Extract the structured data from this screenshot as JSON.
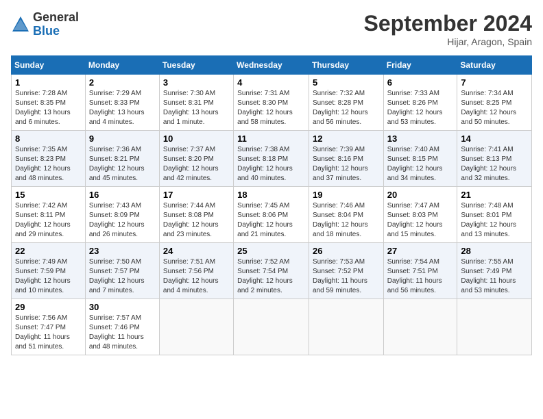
{
  "header": {
    "logo_general": "General",
    "logo_blue": "Blue",
    "month_title": "September 2024",
    "location": "Hijar, Aragon, Spain"
  },
  "columns": [
    "Sunday",
    "Monday",
    "Tuesday",
    "Wednesday",
    "Thursday",
    "Friday",
    "Saturday"
  ],
  "weeks": [
    [
      {
        "day": "1",
        "sunrise": "7:28 AM",
        "sunset": "8:35 PM",
        "daylight": "13 hours and 6 minutes."
      },
      {
        "day": "2",
        "sunrise": "7:29 AM",
        "sunset": "8:33 PM",
        "daylight": "13 hours and 4 minutes."
      },
      {
        "day": "3",
        "sunrise": "7:30 AM",
        "sunset": "8:31 PM",
        "daylight": "13 hours and 1 minute."
      },
      {
        "day": "4",
        "sunrise": "7:31 AM",
        "sunset": "8:30 PM",
        "daylight": "12 hours and 58 minutes."
      },
      {
        "day": "5",
        "sunrise": "7:32 AM",
        "sunset": "8:28 PM",
        "daylight": "12 hours and 56 minutes."
      },
      {
        "day": "6",
        "sunrise": "7:33 AM",
        "sunset": "8:26 PM",
        "daylight": "12 hours and 53 minutes."
      },
      {
        "day": "7",
        "sunrise": "7:34 AM",
        "sunset": "8:25 PM",
        "daylight": "12 hours and 50 minutes."
      }
    ],
    [
      {
        "day": "8",
        "sunrise": "7:35 AM",
        "sunset": "8:23 PM",
        "daylight": "12 hours and 48 minutes."
      },
      {
        "day": "9",
        "sunrise": "7:36 AM",
        "sunset": "8:21 PM",
        "daylight": "12 hours and 45 minutes."
      },
      {
        "day": "10",
        "sunrise": "7:37 AM",
        "sunset": "8:20 PM",
        "daylight": "12 hours and 42 minutes."
      },
      {
        "day": "11",
        "sunrise": "7:38 AM",
        "sunset": "8:18 PM",
        "daylight": "12 hours and 40 minutes."
      },
      {
        "day": "12",
        "sunrise": "7:39 AM",
        "sunset": "8:16 PM",
        "daylight": "12 hours and 37 minutes."
      },
      {
        "day": "13",
        "sunrise": "7:40 AM",
        "sunset": "8:15 PM",
        "daylight": "12 hours and 34 minutes."
      },
      {
        "day": "14",
        "sunrise": "7:41 AM",
        "sunset": "8:13 PM",
        "daylight": "12 hours and 32 minutes."
      }
    ],
    [
      {
        "day": "15",
        "sunrise": "7:42 AM",
        "sunset": "8:11 PM",
        "daylight": "12 hours and 29 minutes."
      },
      {
        "day": "16",
        "sunrise": "7:43 AM",
        "sunset": "8:09 PM",
        "daylight": "12 hours and 26 minutes."
      },
      {
        "day": "17",
        "sunrise": "7:44 AM",
        "sunset": "8:08 PM",
        "daylight": "12 hours and 23 minutes."
      },
      {
        "day": "18",
        "sunrise": "7:45 AM",
        "sunset": "8:06 PM",
        "daylight": "12 hours and 21 minutes."
      },
      {
        "day": "19",
        "sunrise": "7:46 AM",
        "sunset": "8:04 PM",
        "daylight": "12 hours and 18 minutes."
      },
      {
        "day": "20",
        "sunrise": "7:47 AM",
        "sunset": "8:03 PM",
        "daylight": "12 hours and 15 minutes."
      },
      {
        "day": "21",
        "sunrise": "7:48 AM",
        "sunset": "8:01 PM",
        "daylight": "12 hours and 13 minutes."
      }
    ],
    [
      {
        "day": "22",
        "sunrise": "7:49 AM",
        "sunset": "7:59 PM",
        "daylight": "12 hours and 10 minutes."
      },
      {
        "day": "23",
        "sunrise": "7:50 AM",
        "sunset": "7:57 PM",
        "daylight": "12 hours and 7 minutes."
      },
      {
        "day": "24",
        "sunrise": "7:51 AM",
        "sunset": "7:56 PM",
        "daylight": "12 hours and 4 minutes."
      },
      {
        "day": "25",
        "sunrise": "7:52 AM",
        "sunset": "7:54 PM",
        "daylight": "12 hours and 2 minutes."
      },
      {
        "day": "26",
        "sunrise": "7:53 AM",
        "sunset": "7:52 PM",
        "daylight": "11 hours and 59 minutes."
      },
      {
        "day": "27",
        "sunrise": "7:54 AM",
        "sunset": "7:51 PM",
        "daylight": "11 hours and 56 minutes."
      },
      {
        "day": "28",
        "sunrise": "7:55 AM",
        "sunset": "7:49 PM",
        "daylight": "11 hours and 53 minutes."
      }
    ],
    [
      {
        "day": "29",
        "sunrise": "7:56 AM",
        "sunset": "7:47 PM",
        "daylight": "11 hours and 51 minutes."
      },
      {
        "day": "30",
        "sunrise": "7:57 AM",
        "sunset": "7:46 PM",
        "daylight": "11 hours and 48 minutes."
      },
      null,
      null,
      null,
      null,
      null
    ]
  ]
}
